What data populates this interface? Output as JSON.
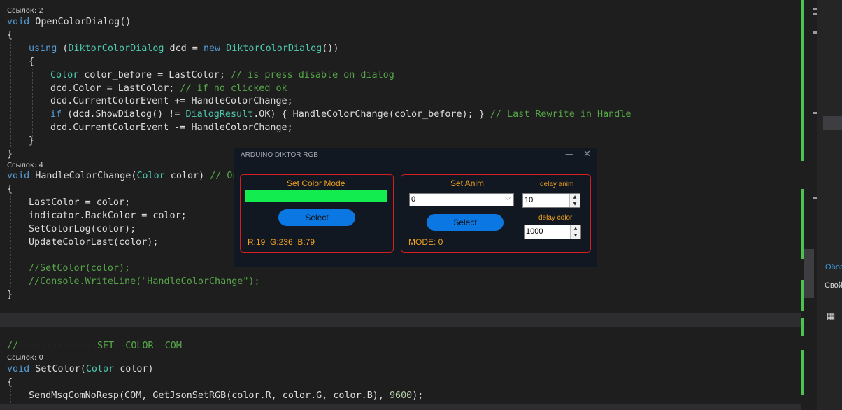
{
  "editor": {
    "refs": [
      "Ссылок: 2",
      "Ссылок: 4",
      "Ссылок: 0"
    ],
    "code_top": [
      {
        "indent": 0,
        "tokens": [
          [
            "kw",
            "void"
          ],
          [
            "pl",
            " OpenColorDialog()"
          ]
        ]
      },
      {
        "indent": 0,
        "tokens": [
          [
            "pl",
            "{"
          ]
        ]
      },
      {
        "indent": 1,
        "tokens": [
          [
            "kw",
            "using"
          ],
          [
            "pl",
            " ("
          ],
          [
            "ty",
            "DiktorColorDialog"
          ],
          [
            "pl",
            " dcd = "
          ],
          [
            "kw",
            "new"
          ],
          [
            "pl",
            " "
          ],
          [
            "ty",
            "DiktorColorDialog"
          ],
          [
            "pl",
            "())"
          ]
        ]
      },
      {
        "indent": 1,
        "tokens": [
          [
            "pl",
            "{"
          ]
        ]
      },
      {
        "indent": 2,
        "tokens": [
          [
            "ty",
            "Color"
          ],
          [
            "pl",
            " color_before = LastColor; "
          ],
          [
            "cm",
            "// is press disable on dialog"
          ]
        ]
      },
      {
        "indent": 2,
        "tokens": [
          [
            "pl",
            "dcd.Color = LastColor; "
          ],
          [
            "cm",
            "// if no clicked ok"
          ]
        ]
      },
      {
        "indent": 2,
        "tokens": [
          [
            "pl",
            "dcd.CurrentColorEvent += HandleColorChange;"
          ]
        ]
      },
      {
        "indent": 2,
        "tokens": [
          [
            "kw",
            "if"
          ],
          [
            "pl",
            " (dcd.ShowDialog() != "
          ],
          [
            "ty",
            "DialogResult"
          ],
          [
            "pl",
            ".OK) { HandleColorChange(color_before); } "
          ],
          [
            "cm",
            "// Last Rewrite in Handle"
          ]
        ]
      },
      {
        "indent": 2,
        "tokens": [
          [
            "pl",
            "dcd.CurrentColorEvent -= HandleColorChange;"
          ]
        ]
      },
      {
        "indent": 1,
        "tokens": [
          [
            "pl",
            "}"
          ]
        ]
      },
      {
        "indent": 0,
        "tokens": [
          [
            "pl",
            "}"
          ]
        ]
      }
    ],
    "code_mid": [
      {
        "indent": 0,
        "tokens": [
          [
            "kw",
            "void"
          ],
          [
            "pl",
            " HandleColorChange("
          ],
          [
            "ty",
            "Color"
          ],
          [
            "pl",
            " color) "
          ],
          [
            "cm",
            "// On"
          ]
        ]
      },
      {
        "indent": 0,
        "tokens": [
          [
            "pl",
            "{"
          ]
        ]
      },
      {
        "indent": 1,
        "tokens": [
          [
            "pl",
            "LastColor = color;"
          ]
        ]
      },
      {
        "indent": 1,
        "tokens": [
          [
            "pl",
            "indicator.BackColor = color;"
          ]
        ]
      },
      {
        "indent": 1,
        "tokens": [
          [
            "pl",
            "SetColorLog(color);"
          ]
        ]
      },
      {
        "indent": 1,
        "tokens": [
          [
            "pl",
            "UpdateColorLast(color);"
          ]
        ]
      },
      {
        "indent": 0,
        "tokens": []
      },
      {
        "indent": 1,
        "tokens": [
          [
            "cm",
            "//SetColor(color);"
          ]
        ]
      },
      {
        "indent": 1,
        "tokens": [
          [
            "cm",
            "//Console.WriteLine(\"HandleColorChange\");"
          ]
        ]
      },
      {
        "indent": 0,
        "tokens": [
          [
            "pl",
            "}"
          ]
        ]
      }
    ],
    "code_bottom_comment": "//--------------SET--COLOR--COM",
    "code_bottom": [
      {
        "indent": 0,
        "tokens": [
          [
            "kw",
            "void"
          ],
          [
            "pl",
            " SetColor("
          ],
          [
            "ty",
            "Color"
          ],
          [
            "pl",
            " color)"
          ]
        ]
      },
      {
        "indent": 0,
        "tokens": [
          [
            "pl",
            "{"
          ]
        ]
      },
      {
        "indent": 1,
        "tokens": [
          [
            "pl",
            "SendMsgComNoResp(COM, GetJsonSetRGB(color.R, color.G, color.B), "
          ],
          [
            "nm",
            "9600"
          ],
          [
            "pl",
            ");"
          ]
        ]
      }
    ]
  },
  "right_panel": {
    "label_1": "Обоз",
    "label_2": "Свой"
  },
  "dialog": {
    "title": "ARDUINO DIKTOR RGB",
    "minimize_glyph": "—",
    "close_glyph": "✕",
    "color_group": {
      "title": "Set Color Mode",
      "indicator_color": "#13EC4F",
      "button": "Select",
      "rgb_text": "R:19  G:236  B:79"
    },
    "anim_group": {
      "title": "Set Anim",
      "anim_select_value": "0",
      "button": "Select",
      "mode_text": "MODE: 0",
      "delay_anim_label": "delay anim",
      "delay_anim_value": "10",
      "delay_color_label": "delay color",
      "delay_color_value": "1000"
    }
  },
  "colors": {
    "accent_border": "#d61e1e",
    "label_orange": "#f0a020",
    "button_blue": "#0b77e3",
    "change_marker_green": "#4ec24e"
  }
}
